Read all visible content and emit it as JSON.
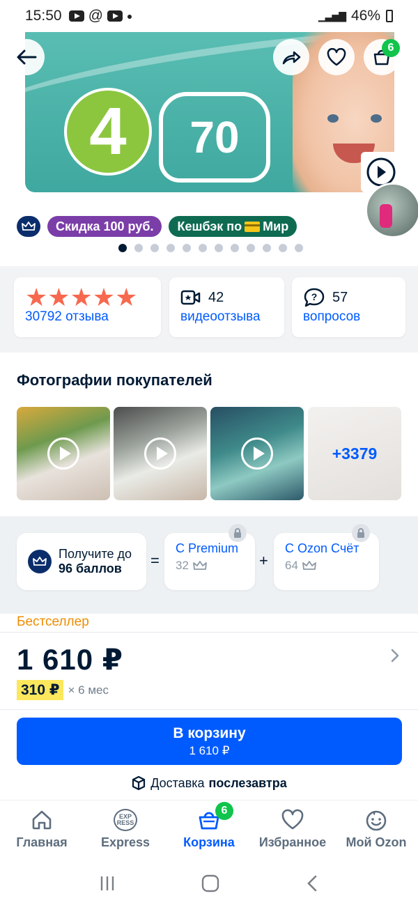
{
  "status_bar": {
    "time": "15:50",
    "at": "@",
    "battery": "46%"
  },
  "product": {
    "size_number": "4",
    "count_number": "70",
    "cart_count": "6"
  },
  "promo": {
    "discount": "Скидка 100 руб.",
    "cashback_prefix": "Кешбэк по",
    "cashback_suffix": "Мир"
  },
  "gallery": {
    "total_slides": 12,
    "active_slide": 1
  },
  "stats": {
    "rating_stars": 5,
    "reviews_count": "30792 отзыва",
    "video_reviews_num": "42",
    "video_reviews_label": "видеоотзыва",
    "questions_num": "57",
    "questions_label": "вопросов"
  },
  "photos_section": {
    "title": "Фотографии покупателей",
    "more_count": "+3379"
  },
  "points": {
    "get_line1": "Получите до",
    "get_line2": "96 баллов",
    "equals": "=",
    "premium_title": "С Premium",
    "premium_value": "32",
    "plus": "+",
    "account_title": "С Ozon Счёт",
    "account_value": "64"
  },
  "pricing": {
    "label": "Бестселлер",
    "price": "1 610 ₽",
    "installment_price": "310 ₽",
    "installment_term": "× 6 мес"
  },
  "cart_button": {
    "label": "В корзину",
    "price": "1 610 ₽"
  },
  "delivery": {
    "prefix": "Доставка",
    "when": "послезавтра"
  },
  "tabbar": {
    "home": "Главная",
    "express": "Express",
    "express_logo_top": "EXP",
    "express_logo_bottom": "RESS",
    "cart": "Корзина",
    "cart_badge": "6",
    "favorites": "Избранное",
    "profile": "Мой Ozon"
  },
  "colors": {
    "accent": "#005bff",
    "star": "#f7694f",
    "badge_green": "#10c44c",
    "bestseller": "#f08c00",
    "highlight": "#fde75c"
  }
}
